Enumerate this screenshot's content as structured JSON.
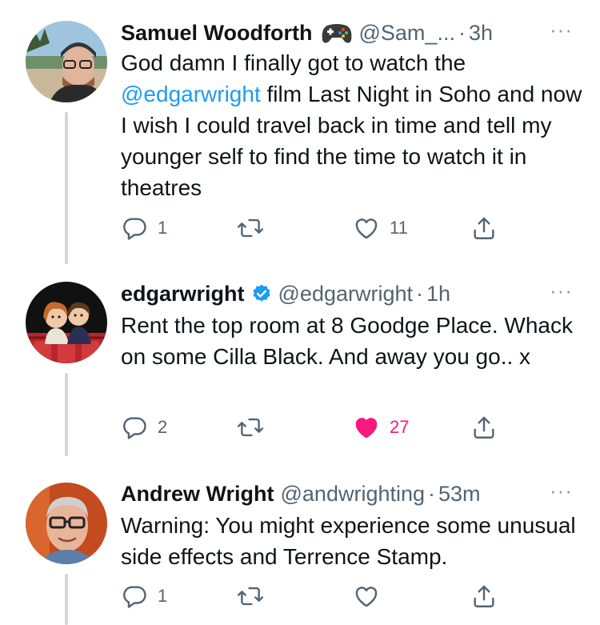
{
  "tweets": [
    {
      "name": "Samuel Woodforth",
      "emoji": "game-controller",
      "handle": "@Sam_...",
      "dot": "·",
      "time": "3h",
      "text_before": "God damn I finally got to watch the ",
      "mention": "@edgarwright",
      "text_after": " film Last Night in Soho and now I wish I could travel back in time and tell my younger self to find the time to watch it in theatres",
      "reply_count": "1",
      "retweet_count": "",
      "like_count": "11",
      "liked": false,
      "more": "···"
    },
    {
      "name": "edgarwright",
      "verified": true,
      "handle": "@edgarwright",
      "dot": "·",
      "time": "1h",
      "text": "Rent the top room at 8 Goodge Place. Whack on some Cilla Black. And away you go.. x",
      "reply_count": "2",
      "retweet_count": "",
      "like_count": "27",
      "liked": true,
      "more": "···"
    },
    {
      "name": "Andrew Wright",
      "handle": "@andwrighting",
      "dot": "·",
      "time": "53m",
      "text": "Warning: You might experience some unusual side effects and Terrence Stamp.",
      "reply_count": "1",
      "retweet_count": "",
      "like_count": "",
      "liked": false,
      "more": "···"
    }
  ],
  "colors": {
    "mention": "#1d9bf0",
    "like_active": "#f91880",
    "muted": "#536471",
    "verified": "#1d9bf0"
  }
}
